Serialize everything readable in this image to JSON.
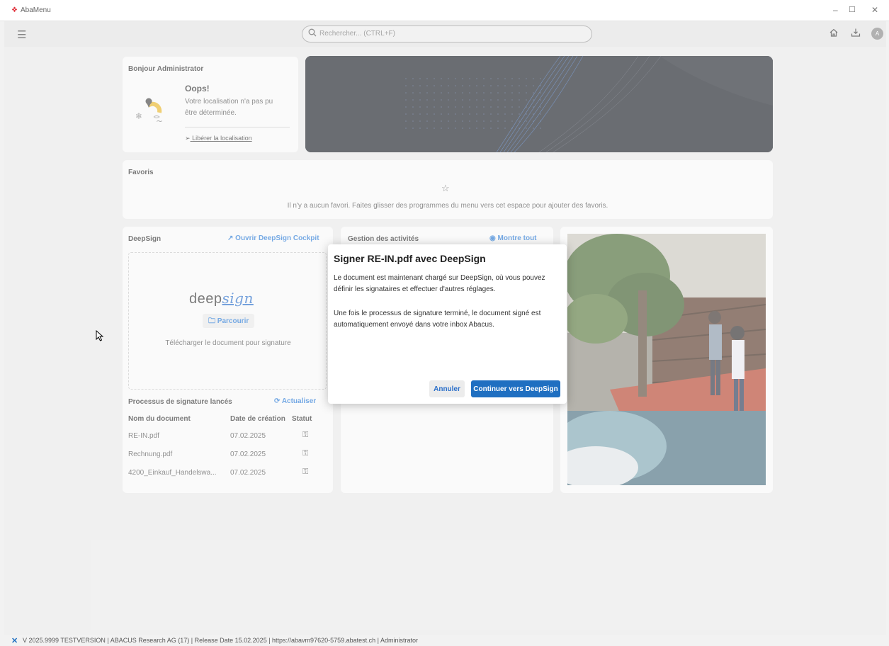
{
  "window": {
    "title": "AbaMenu",
    "controls": [
      "–",
      "☐",
      "✕"
    ]
  },
  "toolbar": {
    "menu_icon": "menu-icon",
    "search_placeholder": "Rechercher... (CTRL+F)",
    "avatar_initial": "A"
  },
  "greeting": {
    "title": "Bonjour Administrator",
    "oops": "Oops!",
    "location_message": "Votre localisation n'a pas pu être déterminée.",
    "location_link": "Libérer la localisation"
  },
  "favoris": {
    "title": "Favoris",
    "empty_message": "Il n'y a aucun favori. Faites glisser des programmes du menu vers cet espace pour ajouter des favoris."
  },
  "deepsign": {
    "title": "DeepSign",
    "open_cockpit": "Ouvrir DeepSign Cockpit",
    "logo_text_plain": "deep",
    "logo_text_script": "sign",
    "browse_label": "Parcourir",
    "upload_message": "Télécharger le document pour signature",
    "processes_title": "Processus de signature lancés",
    "refresh_label": "Actualiser",
    "columns": [
      "Nom du document",
      "Date de création",
      "Statut"
    ],
    "rows": [
      {
        "name": "RE-IN.pdf",
        "date": "07.02.2025",
        "status_icon": "pending-status-icon"
      },
      {
        "name": "Rechnung.pdf",
        "date": "07.02.2025",
        "status_icon": "pending-status-icon"
      },
      {
        "name": "4200_Einkauf_Handelswa...",
        "date": "07.02.2025",
        "status_icon": "pending-status-icon"
      }
    ]
  },
  "activities": {
    "title": "Gestion des activités",
    "show_all": "Montre tout"
  },
  "dialog": {
    "title": "Signer RE-IN.pdf avec DeepSign",
    "paragraph1": "Le document est maintenant chargé sur DeepSign, où vous pouvez définir les signataires et effectuer d'autres réglages.",
    "paragraph2": "Une fois le processus de signature terminé, le document signé est automatiquement envoyé dans votre inbox Abacus.",
    "cancel_label": "Annuler",
    "continue_label": "Continuer vers DeepSign"
  },
  "statusbar": {
    "text": "V 2025.9999 TESTVERSION | ABACUS Research AG (17) | Release Date 15.02.2025 | https://abavm97620-5759.abatest.ch | Administrator"
  },
  "colors": {
    "accent": "#2b7bd6",
    "primary_button": "#1f6fc1",
    "banner": "#1b1f27",
    "logo_red": "#e0303a"
  }
}
